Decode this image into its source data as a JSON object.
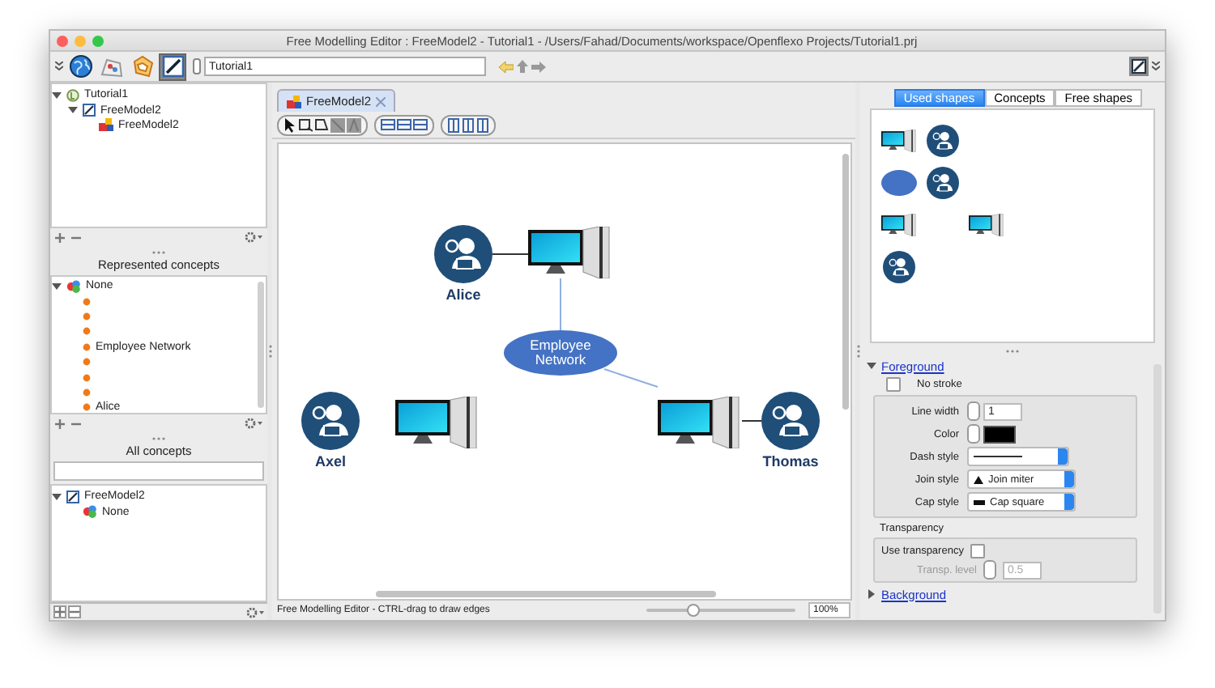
{
  "window": {
    "title": "Free Modelling Editor : FreeModel2 - Tutorial1 - /Users/Fahad/Documents/workspace/Openflexo Projects/Tutorial1.prj"
  },
  "toolbar": {
    "modules": [
      {
        "kind": "globe",
        "selected": false
      },
      {
        "kind": "map",
        "selected": false
      },
      {
        "kind": "shield",
        "selected": false
      },
      {
        "kind": "diagram",
        "selected": true
      }
    ],
    "location": "Tutorial1"
  },
  "project_tree": [
    {
      "label": "Tutorial1",
      "kind": "project",
      "expanded": true,
      "children": [
        {
          "label": "FreeModel2",
          "kind": "model",
          "expanded": true,
          "children": [
            {
              "label": "FreeModel2",
              "kind": "diagram"
            }
          ]
        }
      ]
    }
  ],
  "represented_concepts": {
    "title": "Represented concepts",
    "tree": [
      {
        "label": "None",
        "kind": "concept",
        "expanded": true,
        "children": [
          {
            "kind": "instance"
          },
          {
            "kind": "instance"
          },
          {
            "kind": "instance"
          },
          {
            "kind": "instance",
            "label": "Employee Network"
          },
          {
            "kind": "instance"
          },
          {
            "kind": "instance"
          },
          {
            "kind": "instance"
          },
          {
            "kind": "instance",
            "label": "Alice"
          }
        ]
      }
    ]
  },
  "all_concepts": {
    "title": "All concepts",
    "tree": [
      {
        "label": "FreeModel2",
        "kind": "model",
        "expanded": true,
        "children": [
          {
            "label": "None",
            "kind": "concept"
          }
        ]
      }
    ]
  },
  "editor": {
    "tab": {
      "label": "FreeModel2",
      "selected": true
    },
    "nodes": [
      {
        "kind": "person",
        "label": "Alice"
      },
      {
        "kind": "computer"
      },
      {
        "kind": "ellipse",
        "label": "Employee Network"
      },
      {
        "kind": "person",
        "label": "Axel"
      },
      {
        "kind": "computer"
      },
      {
        "kind": "computer"
      },
      {
        "kind": "person",
        "label": "Thomas"
      }
    ],
    "status": "Free Modelling Editor - CTRL-drag to draw edges",
    "zoom": {
      "level": 0.31,
      "reading": "100%"
    }
  },
  "inspector": {
    "tabs": [
      {
        "label": "Used shapes",
        "selected": true
      },
      {
        "label": "Concepts",
        "selected": false
      },
      {
        "label": "Free shapes",
        "selected": false
      }
    ],
    "palette": [
      [
        {
          "kind": "computer"
        },
        {
          "kind": "person"
        }
      ],
      [
        {
          "kind": "ellipse"
        },
        {
          "kind": "person"
        }
      ],
      [
        {
          "kind": "computer"
        },
        {
          "kind": "blank"
        },
        {
          "kind": "computer"
        }
      ],
      [
        {
          "kind": "person"
        }
      ]
    ],
    "foreground": {
      "label": "Foreground",
      "expanded": true,
      "no_stroke": {
        "label": "No stroke",
        "checked": false
      },
      "fields": [
        {
          "label": "Line width",
          "kind": "spinner",
          "value": "1"
        },
        {
          "label": "Color",
          "kind": "color",
          "color": "#000000"
        },
        {
          "label": "Dash style",
          "kind": "dash"
        },
        {
          "label": "Join style",
          "kind": "join",
          "value": "Join miter"
        },
        {
          "label": "Cap style",
          "kind": "cap",
          "value": "Cap square"
        }
      ]
    },
    "transparency": {
      "title": "Transparency",
      "use": {
        "label": "Use transparency",
        "checked": false
      },
      "level": {
        "label": "Transp. level",
        "value": "0.5",
        "disabled": true
      }
    },
    "background": {
      "label": "Background",
      "expanded": false
    }
  }
}
